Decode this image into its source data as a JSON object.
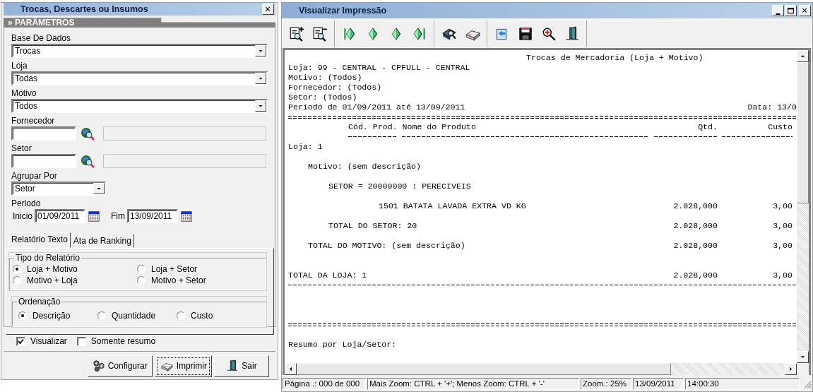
{
  "parameters_window": {
    "title": "Trocas, Descartes ou Insumos",
    "section": "» PARÂMETROS",
    "combos": [
      {
        "label": "Base De Dados",
        "value": "Trocas"
      },
      {
        "label": "Loja",
        "value": "Todas"
      },
      {
        "label": "Motivo",
        "value": "Todos"
      }
    ],
    "lookups": [
      {
        "label": "Fornecedor"
      },
      {
        "label": "Setor"
      }
    ],
    "group_by": {
      "label": "Agrupar Por",
      "value": "Setor"
    },
    "period": {
      "label": "Periodo",
      "start_label": "Inicio",
      "start": "01/09/2011",
      "end_label": "Fim",
      "end": "13/09/2011"
    },
    "tabs": [
      {
        "label": "Relatório Texto",
        "selected": true
      },
      {
        "label": "Ata de Ranking",
        "selected": false
      }
    ],
    "report_type": {
      "title": "Tipo do Relatório",
      "options": [
        {
          "label": "Loja + Motivo",
          "selected": true
        },
        {
          "label": "Loja + Setor",
          "selected": false
        },
        {
          "label": "Motivo + Loja",
          "selected": false
        },
        {
          "label": "Motivo + Setor",
          "selected": false
        }
      ]
    },
    "ordering": {
      "title": "Ordenação",
      "options": [
        {
          "label": "Descrição",
          "selected": true
        },
        {
          "label": "Quantidade",
          "selected": false
        },
        {
          "label": "Custo",
          "selected": false
        }
      ]
    },
    "checkboxes": [
      {
        "label": "Visualizar",
        "checked": true
      },
      {
        "label": "Somente resumo",
        "checked": false
      }
    ],
    "buttons": [
      {
        "kind": "configure",
        "label": "Configurar",
        "focused": false
      },
      {
        "kind": "print",
        "label": "Imprimir",
        "focused": true
      },
      {
        "kind": "exit",
        "label": "Sair",
        "focused": false
      }
    ]
  },
  "preview_window": {
    "title": "Visualizar Impressão",
    "report": {
      "lines": [
        {
          "kind": "title",
          "text": "Trocas de Mercadoria (Loja + Motivo)"
        },
        {
          "kind": "info",
          "text": "Loja: 99 - CENTRAL - CPFULL - CENTRAL"
        },
        {
          "kind": "info",
          "text": "Motivo: (Todos)"
        },
        {
          "kind": "info",
          "text": "Fornecedor: (Todos)"
        },
        {
          "kind": "info",
          "text": "Setor: (Todos)"
        },
        {
          "kind": "info",
          "text": "Período de 01/09/2011 até 13/09/2011",
          "right": "Data: 13/0"
        },
        {
          "kind": "double_rule"
        },
        {
          "kind": "columns",
          "columns": [
            "Cód. Prod.",
            "Nome do Produto",
            "Qtd.",
            "Custo"
          ]
        },
        {
          "kind": "column_rule"
        },
        {
          "kind": "store",
          "text": "Loja: 1"
        },
        {
          "kind": "blank"
        },
        {
          "kind": "reason",
          "text": "Motivo: (sem descrição)"
        },
        {
          "kind": "blank"
        },
        {
          "kind": "sector",
          "text": "SETOR = 20000000 : PERECIVEIS"
        },
        {
          "kind": "blank"
        },
        {
          "kind": "item",
          "text": "1501 BATATA LAVADA EXTRA VD KG",
          "qty": "2.028,000",
          "cost": "3,00"
        },
        {
          "kind": "blank"
        },
        {
          "kind": "sector",
          "text": "TOTAL DO SETOR: 20",
          "qty": "2.028,000",
          "cost": "3,00"
        },
        {
          "kind": "blank"
        },
        {
          "kind": "reason",
          "text": "TOTAL DO MOTIVO: (sem descrição)",
          "qty": "2.028,000",
          "cost": "3,00"
        },
        {
          "kind": "blank"
        },
        {
          "kind": "blank"
        },
        {
          "kind": "store",
          "text": "TOTAL DA LOJA: 1",
          "qty": "2.028,000",
          "cost": "3,00"
        },
        {
          "kind": "single_rule"
        },
        {
          "kind": "blank"
        },
        {
          "kind": "blank"
        },
        {
          "kind": "blank"
        },
        {
          "kind": "double_rule"
        },
        {
          "kind": "blank"
        },
        {
          "kind": "store",
          "text": "Resumo por Loja/Setor:"
        }
      ]
    },
    "status_bar": [
      "Página .: 000 de 000",
      "Mais Zoom: CTRL + '+'; Menos Zoom: CTRL + '-'",
      "Zoom.: 25%",
      "13/09/2011",
      "14:00:30"
    ]
  }
}
